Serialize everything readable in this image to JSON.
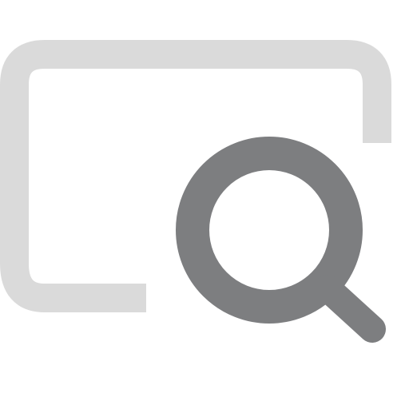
{
  "icon": {
    "name": "window-search-icon",
    "parts": {
      "frame": "window-frame-icon",
      "magnifier": "magnifier-icon"
    },
    "colors": {
      "frame": "#dadada",
      "magnifier": "#7d7e80",
      "background": "#ffffff"
    }
  }
}
